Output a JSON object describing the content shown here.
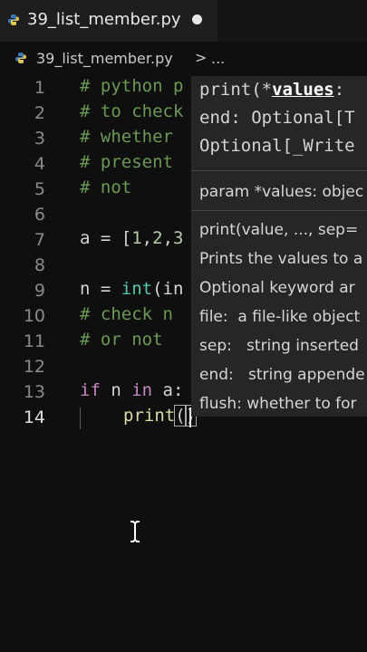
{
  "tab": {
    "label": "39_list_member.py"
  },
  "breadcrumb": {
    "file": "39_list_member.py",
    "sep": ">",
    "more": "..."
  },
  "editor": {
    "line_numbers": [
      "1",
      "2",
      "3",
      "4",
      "5",
      "6",
      "7",
      "8",
      "9",
      "10",
      "11",
      "12",
      "13",
      "14"
    ],
    "lines": {
      "l1": "# python p",
      "l2": "# to check",
      "l3": "# whether",
      "l4": "# present",
      "l5": "# not",
      "l7a": "a = [",
      "l7b": "1",
      "l7c": ",",
      "l7d": "2",
      "l7e": ",",
      "l7f": "3",
      "l9a": "n = ",
      "l9b": "int",
      "l9c": "(in",
      "l10": "# check n",
      "l11": "# or not",
      "l13a": "if",
      "l13b": " n ",
      "l13c": "in",
      "l13d": " a:",
      "l14a": "print",
      "l14b": "(",
      "l14c": ")"
    }
  },
  "hover": {
    "sig1a": "print(*",
    "sig1b": "values",
    "sig1c": ":",
    "sig2": "end: Optional[T",
    "sig3": "Optional[_Write",
    "param": "param *values: objec",
    "doc1": "print(value, ..., sep=",
    "doc2": "Prints the values to a",
    "doc3": "Optional keyword ar",
    "doc4": "file:  a file-like object",
    "doc5": "sep:   string inserted",
    "doc6": "end:   string appende",
    "doc7": "flush: whether to for"
  },
  "colors": {
    "comment": "#6a9955",
    "keyword": "#c586c0",
    "function": "#dcdcaa",
    "number": "#b5cea8",
    "builtin": "#4ec9b0"
  }
}
